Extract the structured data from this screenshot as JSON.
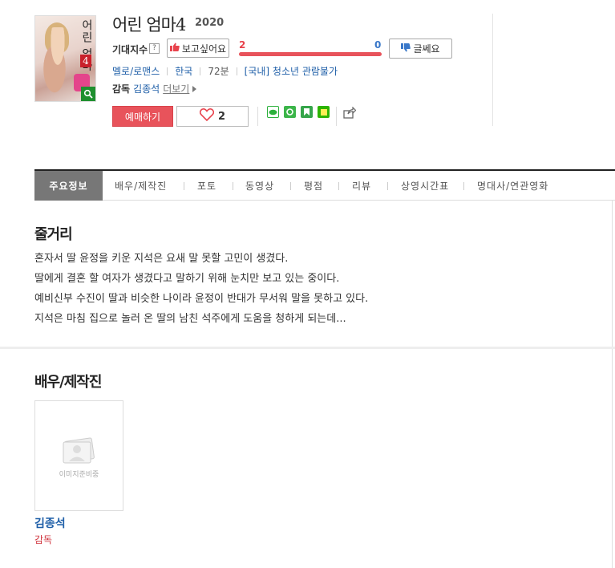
{
  "movie": {
    "title": "어린 엄마4",
    "year": "2020",
    "poster_title": "어린 엄마",
    "poster_number": "4"
  },
  "expectation": {
    "label": "기대지수",
    "help": "?",
    "want_label": "보고싶어요",
    "want_count": "2",
    "meh_label": "글쎄요",
    "meh_count": "0",
    "want_ratio": 1.0
  },
  "meta": {
    "genre": "멜로/로맨스",
    "country": "한국",
    "runtime": "72분",
    "rating": "[국내] 청소년 관람불가"
  },
  "director": {
    "label": "감독",
    "name": "김종석",
    "more": "더보기"
  },
  "actions": {
    "reserve_label": "예매하기",
    "like_count": "2"
  },
  "tabs": [
    {
      "label": "주요정보",
      "active": true
    },
    {
      "label": "배우/제작진"
    },
    {
      "label": "포토"
    },
    {
      "label": "동영상"
    },
    {
      "label": "평점"
    },
    {
      "label": "리뷰"
    },
    {
      "label": "상영시간표"
    },
    {
      "label": "명대사/연관영화"
    }
  ],
  "synopsis": {
    "title": "줄거리",
    "lines": [
      "혼자서 딸 윤정을 키운 지석은 요새 말 못할 고민이 생겼다.",
      " 딸에게 결혼 할 여자가 생겼다고 말하기 위해 눈치만 보고 있는 중이다.",
      " 예비신부 수진이 딸과 비슷한 나이라 윤정이 반대가 무서워 말을 못하고 있다.",
      " 지석은 마침 집으로 놀러 온 딸의 남친 석주에게 도움을 청하게 되는데..."
    ]
  },
  "cast": {
    "title": "배우/제작진",
    "no_image_text": "이미지준비중",
    "members": [
      {
        "name": "김종석",
        "role": "감독"
      }
    ]
  },
  "colors": {
    "accent_red": "#e8535b",
    "link_blue": "#1f5fa8",
    "meh_blue": "#3a78c9"
  }
}
